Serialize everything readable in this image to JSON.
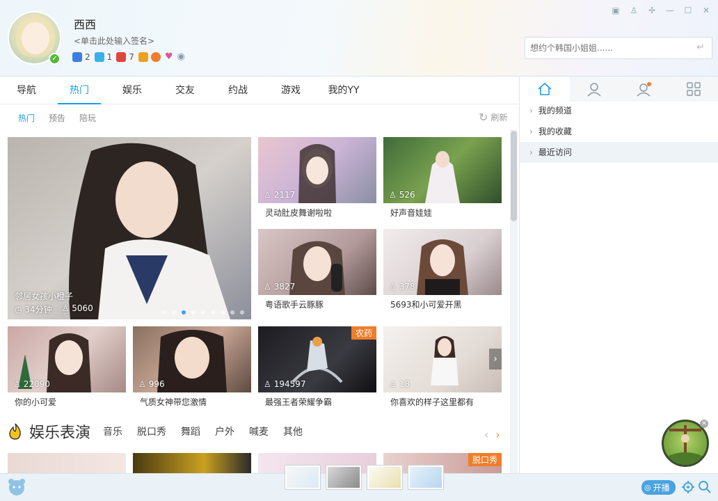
{
  "profile": {
    "nickname": "西西",
    "signature": "<单击此处输入签名>",
    "badges": [
      {
        "icon": "game-icon",
        "count": "2",
        "color": "#3b7fe0"
      },
      {
        "icon": "diamond-icon",
        "count": "1",
        "color": "#3bb0e8"
      },
      {
        "icon": "vip-icon",
        "count": "7",
        "color": "#e0453b"
      },
      {
        "icon": "video-icon",
        "count": "",
        "color": "#f0a020"
      },
      {
        "icon": "face-icon",
        "count": "",
        "color": "#f07d2a"
      },
      {
        "icon": "heart-icon",
        "count": "",
        "color": "#e0559a"
      },
      {
        "icon": "eye-icon",
        "count": "",
        "color": "#8899aa"
      }
    ]
  },
  "search": {
    "placeholder": "想约个韩国小姐姐......"
  },
  "tabs": [
    "导航",
    "热门",
    "娱乐",
    "交友",
    "约战",
    "游戏",
    "我的YY"
  ],
  "active_tab": "热门",
  "subtabs": [
    "热门",
    "预告",
    "陪玩"
  ],
  "refresh_label": "刷新",
  "hero": {
    "title": "邻居女孩小橙子",
    "duration": "34分钟",
    "viewers": "5060",
    "slides": 9,
    "active_slide": 3
  },
  "cards": [
    {
      "title": "灵动肚皮舞谢啦啦",
      "viewers": "2117",
      "tag": ""
    },
    {
      "title": "好声音娃娃",
      "viewers": "526",
      "tag": ""
    },
    {
      "title": "粤语歌手云豚豚",
      "viewers": "3827",
      "tag": ""
    },
    {
      "title": "5693和小可爱开黑",
      "viewers": "378",
      "tag": ""
    },
    {
      "title": "你的小可爱",
      "viewers": "22090",
      "tag": ""
    },
    {
      "title": "气质女神带您激情",
      "viewers": "996",
      "tag": ""
    },
    {
      "title": "最强王者荣耀争霸",
      "viewers": "194597",
      "tag": "农药"
    },
    {
      "title": "你喜欢的样子这里都有",
      "viewers": "18",
      "tag": ""
    }
  ],
  "section": {
    "title": "娱乐表演",
    "categories": [
      "音乐",
      "脱口秀",
      "舞蹈",
      "户外",
      "喊麦",
      "其他"
    ],
    "preview_tag": "脱口秀"
  },
  "right_panel": {
    "tabs": [
      "home-icon",
      "contact-icon",
      "friend-notify-icon",
      "apps-icon"
    ],
    "items": [
      "我的频道",
      "我的收藏",
      "最近访问"
    ]
  },
  "bottom": {
    "broadcast_label": "开播"
  },
  "colors": {
    "accent": "#1e9be8",
    "tag": "#f07d2a",
    "broadcast": "#4aa3df"
  }
}
